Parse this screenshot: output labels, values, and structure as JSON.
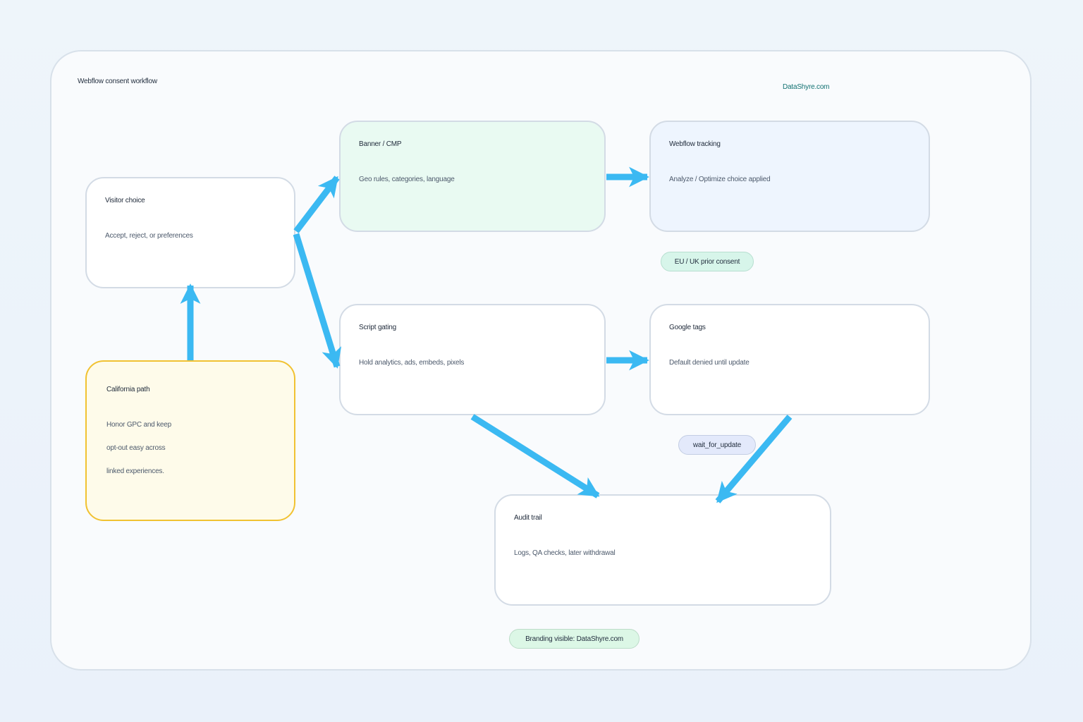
{
  "diagram": {
    "title": "Webflow consent workflow",
    "brand": "DataShyre.com",
    "nodes": {
      "visitor_choice": {
        "title": "Visitor choice",
        "desc": "Accept, reject, or preferences"
      },
      "california_path": {
        "title": "California path",
        "lines": [
          "Honor GPC and keep",
          "opt-out easy across",
          "linked experiences."
        ]
      },
      "banner_cmp": {
        "title": "Banner / CMP",
        "desc": "Geo rules, categories, language"
      },
      "webflow_tracking": {
        "title": "Webflow tracking",
        "desc": "Analyze / Optimize choice applied"
      },
      "script_gating": {
        "title": "Script gating",
        "desc": "Hold analytics, ads, embeds, pixels"
      },
      "google_tags": {
        "title": "Google tags",
        "desc": "Default denied until update"
      },
      "audit_trail": {
        "title": "Audit trail",
        "desc": "Logs, QA checks, later withdrawal"
      }
    },
    "pills": {
      "eu_uk": "EU / UK prior consent",
      "wait_for_update": "wait_for_update",
      "branding": "Branding visible: DataShyre.com"
    }
  },
  "colors": {
    "arrow": "#3bb9f2",
    "banner_fill": "#e9faf2",
    "tracking_fill": "#eef5fe",
    "california_fill": "#fefbea",
    "california_border": "#f1c232",
    "node_border": "#d3dbe5"
  }
}
